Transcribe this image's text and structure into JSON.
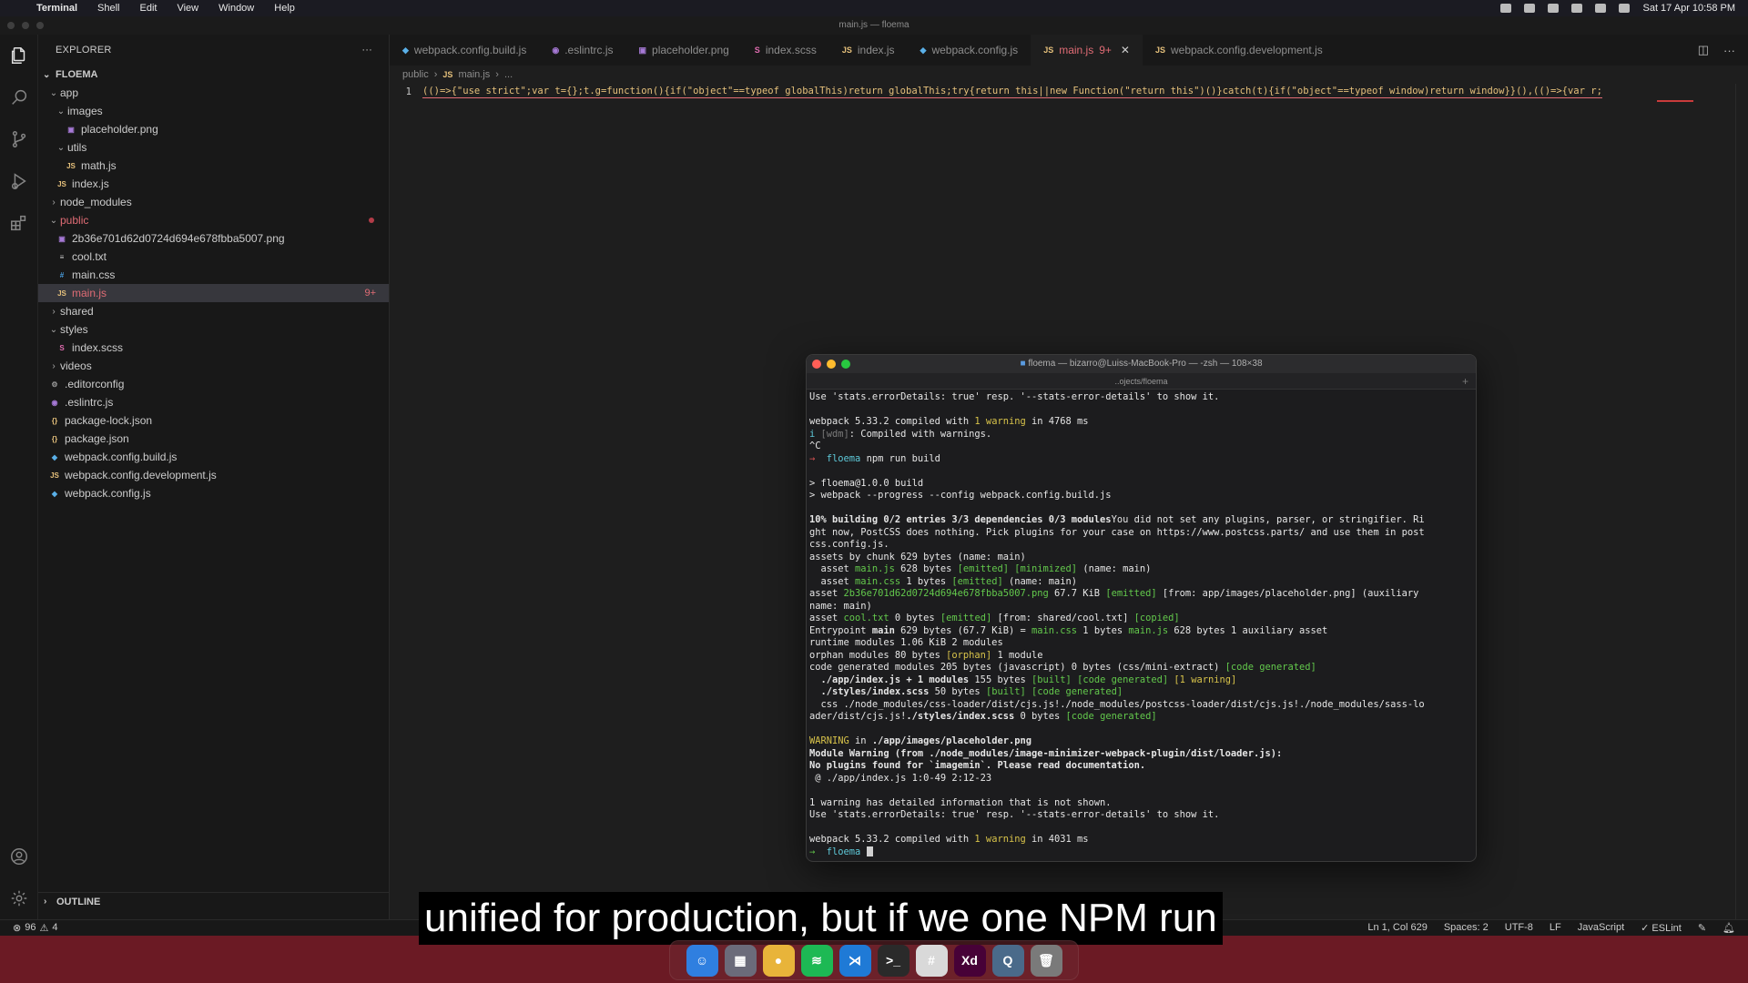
{
  "menubar": {
    "app": "Terminal",
    "items": [
      "Shell",
      "Edit",
      "View",
      "Window",
      "Help"
    ],
    "clock": "Sat 17 Apr 10:58 PM"
  },
  "window": {
    "title": "main.js — floema"
  },
  "explorer": {
    "header": "EXPLORER",
    "more_icon": "ellipsis-icon",
    "root": "FLOEMA",
    "tree": [
      {
        "label": "app",
        "indent": 1,
        "kind": "folder-open"
      },
      {
        "label": "images",
        "indent": 2,
        "kind": "folder-open"
      },
      {
        "label": "placeholder.png",
        "indent": 3,
        "kind": "image"
      },
      {
        "label": "utils",
        "indent": 2,
        "kind": "folder-open"
      },
      {
        "label": "math.js",
        "indent": 3,
        "kind": "js"
      },
      {
        "label": "index.js",
        "indent": 2,
        "kind": "js"
      },
      {
        "label": "node_modules",
        "indent": 1,
        "kind": "folder"
      },
      {
        "label": "public",
        "indent": 1,
        "kind": "folder-open",
        "error": true,
        "dot": true
      },
      {
        "label": "2b36e701d62d0724d694e678fbba5007.png",
        "indent": 2,
        "kind": "image"
      },
      {
        "label": "cool.txt",
        "indent": 2,
        "kind": "text"
      },
      {
        "label": "main.css",
        "indent": 2,
        "kind": "css"
      },
      {
        "label": "main.js",
        "indent": 2,
        "kind": "js",
        "error": true,
        "selected": true,
        "badge": "9+"
      },
      {
        "label": "shared",
        "indent": 1,
        "kind": "folder"
      },
      {
        "label": "styles",
        "indent": 1,
        "kind": "folder-open"
      },
      {
        "label": "index.scss",
        "indent": 2,
        "kind": "scss"
      },
      {
        "label": "videos",
        "indent": 1,
        "kind": "folder"
      },
      {
        "label": ".editorconfig",
        "indent": 1,
        "kind": "config"
      },
      {
        "label": ".eslintrc.js",
        "indent": 1,
        "kind": "eslint"
      },
      {
        "label": "package-lock.json",
        "indent": 1,
        "kind": "json"
      },
      {
        "label": "package.json",
        "indent": 1,
        "kind": "json"
      },
      {
        "label": "webpack.config.build.js",
        "indent": 1,
        "kind": "webpack"
      },
      {
        "label": "webpack.config.development.js",
        "indent": 1,
        "kind": "js"
      },
      {
        "label": "webpack.config.js",
        "indent": 1,
        "kind": "webpack"
      }
    ],
    "outline": "OUTLINE"
  },
  "tabs": [
    {
      "label": "webpack.config.build.js",
      "icon": "webpack"
    },
    {
      "label": ".eslintrc.js",
      "icon": "eslint"
    },
    {
      "label": "placeholder.png",
      "icon": "image"
    },
    {
      "label": "index.scss",
      "icon": "scss"
    },
    {
      "label": "index.js",
      "icon": "js"
    },
    {
      "label": "webpack.config.js",
      "icon": "webpack"
    },
    {
      "label": "main.js",
      "icon": "js",
      "active": true,
      "badge": "9+"
    },
    {
      "label": "webpack.config.development.js",
      "icon": "js"
    }
  ],
  "breadcrumb": [
    "public",
    "main.js",
    "..."
  ],
  "code": {
    "line_number": "1",
    "text": "(()=>{\"use strict\";var t={};t.g=function(){if(\"object\"==typeof globalThis)return globalThis;try{return this||new Function(\"return this\")()}catch(t){if(\"object\"==typeof window)return window}}(),(()=>{var r;"
  },
  "statusbar": {
    "errors": "96",
    "warnings": "4",
    "position": "Ln 1, Col 629",
    "spaces": "Spaces: 2",
    "encoding": "UTF-8",
    "eol": "LF",
    "language": "JavaScript",
    "linter": "✓ ESLint"
  },
  "terminal": {
    "title": "floema — bizarro@Luiss-MacBook-Pro — -zsh — 108×38",
    "tab": "..ojects/floema",
    "lines": [
      [
        [
          "Use 'stats.errorDetails: true' resp. '--stats-error-details' to show it.",
          ""
        ]
      ],
      [],
      [
        [
          "webpack 5.33.2 compiled with ",
          ""
        ],
        [
          "1 warning",
          "yellow"
        ],
        [
          " in 4768 ms",
          ""
        ]
      ],
      [
        [
          "i ",
          "cyan"
        ],
        [
          "[wdm]",
          "dim"
        ],
        [
          ": Compiled with warnings.",
          ""
        ]
      ],
      [
        [
          "^C",
          ""
        ]
      ],
      [
        [
          "→  ",
          "red"
        ],
        [
          "floema",
          "cyan"
        ],
        [
          " npm run build",
          ""
        ]
      ],
      [],
      [
        [
          "> floema@1.0.0 build",
          ""
        ]
      ],
      [
        [
          "> webpack --progress --config webpack.config.build.js",
          ""
        ]
      ],
      [],
      [
        [
          "10% building 0/2 entries 3/3 dependencies 0/3 modules",
          "bold"
        ],
        [
          "You did not set any plugins, parser, or stringifier. Ri",
          ""
        ]
      ],
      [
        [
          "ght now, PostCSS does nothing. Pick plugins for your case on https://www.postcss.parts/ and use them in post",
          ""
        ]
      ],
      [
        [
          "css.config.js.",
          ""
        ]
      ],
      [
        [
          "assets by chunk 629 bytes (name: main)",
          ""
        ]
      ],
      [
        [
          "  asset ",
          ""
        ],
        [
          "main.js",
          "green"
        ],
        [
          " 628 bytes ",
          ""
        ],
        [
          "[emitted]",
          "green"
        ],
        [
          " ",
          ""
        ],
        [
          "[minimized]",
          "green"
        ],
        [
          " (name: main)",
          ""
        ]
      ],
      [
        [
          "  asset ",
          ""
        ],
        [
          "main.css",
          "green"
        ],
        [
          " 1 bytes ",
          ""
        ],
        [
          "[emitted]",
          "green"
        ],
        [
          " (name: main)",
          ""
        ]
      ],
      [
        [
          "asset ",
          ""
        ],
        [
          "2b36e701d62d0724d694e678fbba5007.png",
          "green"
        ],
        [
          " 67.7 KiB ",
          ""
        ],
        [
          "[emitted]",
          "green"
        ],
        [
          " [from: app/images/placeholder.png] (auxiliary",
          ""
        ]
      ],
      [
        [
          "name: main)",
          ""
        ]
      ],
      [
        [
          "asset ",
          ""
        ],
        [
          "cool.txt",
          "green"
        ],
        [
          " 0 bytes ",
          ""
        ],
        [
          "[emitted]",
          "green"
        ],
        [
          " [from: shared/cool.txt] ",
          ""
        ],
        [
          "[copied]",
          "green"
        ]
      ],
      [
        [
          "Entrypoint ",
          ""
        ],
        [
          "main",
          "bold"
        ],
        [
          " 629 bytes (67.7 KiB) = ",
          ""
        ],
        [
          "main.css",
          "green"
        ],
        [
          " 1 bytes ",
          ""
        ],
        [
          "main.js",
          "green"
        ],
        [
          " 628 bytes 1 auxiliary asset",
          ""
        ]
      ],
      [
        [
          "runtime modules 1.06 KiB 2 modules",
          ""
        ]
      ],
      [
        [
          "orphan modules 80 bytes ",
          ""
        ],
        [
          "[orphan]",
          "yellow"
        ],
        [
          " 1 module",
          ""
        ]
      ],
      [
        [
          "code generated modules 205 bytes (javascript) 0 bytes (css/mini-extract) ",
          ""
        ],
        [
          "[code generated]",
          "green"
        ]
      ],
      [
        [
          "  ./app/index.js + 1 modules",
          "bold"
        ],
        [
          " 155 bytes ",
          ""
        ],
        [
          "[built]",
          "green"
        ],
        [
          " ",
          ""
        ],
        [
          "[code generated]",
          "green"
        ],
        [
          " ",
          ""
        ],
        [
          "[1 warning]",
          "yellow"
        ]
      ],
      [
        [
          "  ./styles/index.scss",
          "bold"
        ],
        [
          " 50 bytes ",
          ""
        ],
        [
          "[built]",
          "green"
        ],
        [
          " ",
          ""
        ],
        [
          "[code generated]",
          "green"
        ]
      ],
      [
        [
          "  css ./node_modules/css-loader/dist/cjs.js!./node_modules/postcss-loader/dist/cjs.js!./node_modules/sass-lo",
          ""
        ]
      ],
      [
        [
          "ader/dist/cjs.js!",
          ""
        ],
        [
          "./styles/index.scss",
          "bold"
        ],
        [
          " 0 bytes ",
          ""
        ],
        [
          "[code generated]",
          "green"
        ]
      ],
      [],
      [
        [
          "WARNING",
          "yellow"
        ],
        [
          " in ",
          ""
        ],
        [
          "./app/images/placeholder.png",
          "bold"
        ]
      ],
      [
        [
          "Module Warning (from ./node_modules/image-minimizer-webpack-plugin/dist/loader.js):",
          "bold"
        ]
      ],
      [
        [
          "No plugins found for `imagemin`. Please read documentation.",
          "bold"
        ]
      ],
      [
        [
          " @ ./app/index.js 1:0-49 2:12-23",
          ""
        ]
      ],
      [],
      [
        [
          "1 warning has detailed information that is not shown.",
          ""
        ]
      ],
      [
        [
          "Use 'stats.errorDetails: true' resp. '--stats-error-details' to show it.",
          ""
        ]
      ],
      [],
      [
        [
          "webpack 5.33.2 compiled with ",
          ""
        ],
        [
          "1 warning",
          "yellow"
        ],
        [
          " in 4031 ms",
          ""
        ]
      ],
      [
        [
          "→  ",
          "green"
        ],
        [
          "floema",
          "cyan"
        ],
        [
          " ",
          ""
        ]
      ]
    ]
  },
  "subtitle": "unified for production, but if we one NPM run",
  "dock": [
    {
      "name": "finder",
      "color": "#2f7fe0",
      "glyph": "☺"
    },
    {
      "name": "launchpad",
      "color": "#6b6b7a",
      "glyph": "▦"
    },
    {
      "name": "chrome",
      "color": "#e8b43a",
      "glyph": "●"
    },
    {
      "name": "spotify",
      "color": "#1db954",
      "glyph": "≋"
    },
    {
      "name": "vscode",
      "color": "#1f7ad6",
      "glyph": "⋊"
    },
    {
      "name": "terminal",
      "color": "#2a2a2a",
      "glyph": ">_"
    },
    {
      "name": "slack",
      "color": "#d9d9d9",
      "glyph": "#"
    },
    {
      "name": "xd",
      "color": "#470137",
      "glyph": "Xd"
    },
    {
      "name": "quicktime",
      "color": "#4a6a8a",
      "glyph": "Q"
    },
    {
      "name": "trash",
      "color": "#7a7a7a",
      "glyph": "🗑"
    }
  ]
}
